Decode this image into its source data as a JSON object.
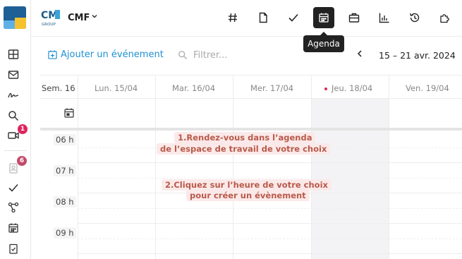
{
  "topbar": {
    "brand": "CMF",
    "brand_sub": "GROUP",
    "tooltip": "Agenda",
    "buttons": [
      {
        "name": "hash-icon"
      },
      {
        "name": "document-icon"
      },
      {
        "name": "check-icon"
      },
      {
        "name": "calendar-icon",
        "active": true
      },
      {
        "name": "briefcase-icon"
      },
      {
        "name": "chart-icon"
      },
      {
        "name": "history-icon"
      },
      {
        "name": "puzzle-icon"
      }
    ]
  },
  "rail": {
    "badges": {
      "video": "1",
      "contacts": "6"
    }
  },
  "toolbar": {
    "add_event": "Ajouter un événement",
    "filter_placeholder": "Filtrer...",
    "prev": "‹",
    "date_range": "15 – 21 avr. 2024"
  },
  "calendar": {
    "week": "Sem. 16",
    "days": [
      "Lun. 15/04",
      "Mar. 16/04",
      "Mer. 17/04",
      "Jeu. 18/04",
      "Ven. 19/04"
    ],
    "today_index": 3,
    "hours": [
      "06 h",
      "07 h",
      "08 h",
      "09 h"
    ]
  },
  "instructions": {
    "step1_line1": "1.Rendez-vous dans l’agenda",
    "step1_line2": "de l’espace de travail de votre choix",
    "step2_line1": "2.Cliquez sur l’heure de votre choix",
    "step2_line2": "pour créer un évènement"
  },
  "colors": {
    "accent": "#1f8fd0",
    "badge": "#e0245e",
    "annotation_text": "#b85a4a",
    "annotation_bg": "#fbe9e9"
  }
}
